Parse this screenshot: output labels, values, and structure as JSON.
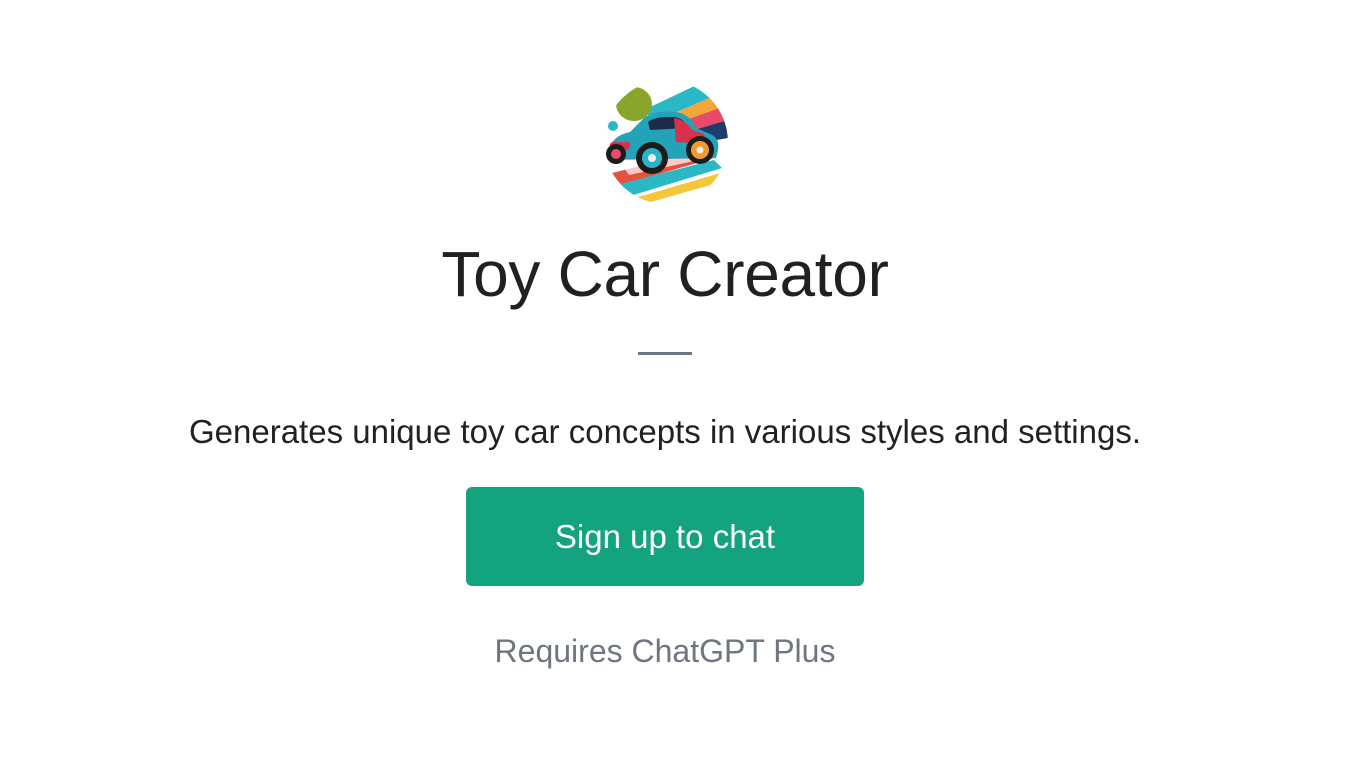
{
  "gpt": {
    "title": "Toy Car Creator",
    "description": "Generates unique toy car concepts in various styles and settings.",
    "avatar_icon": "toy-car-avatar"
  },
  "actions": {
    "signup_label": "Sign up to chat",
    "requirement": "Requires ChatGPT Plus"
  },
  "colors": {
    "button": "#13a37f",
    "title_text": "#202123",
    "muted_text": "#6e7681"
  }
}
